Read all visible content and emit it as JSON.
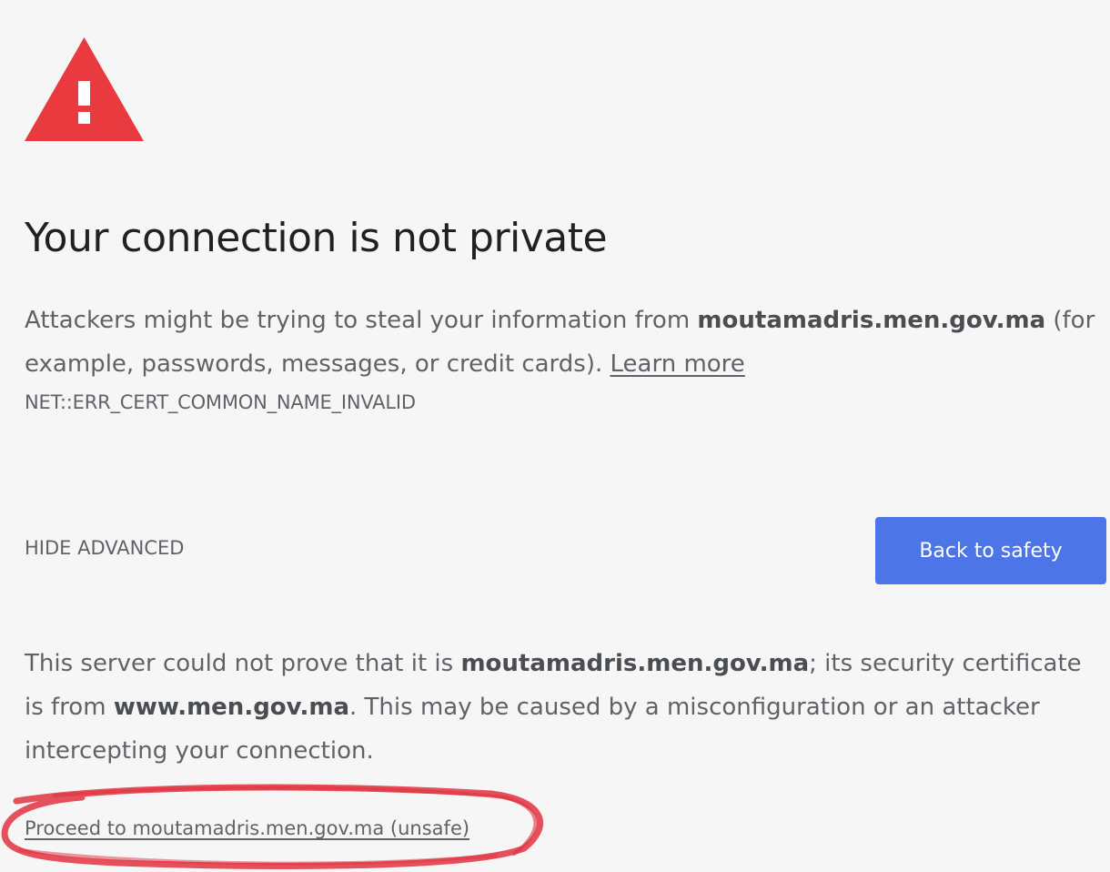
{
  "icon": {
    "name": "warning-triangle-icon",
    "color": "#e83a3f"
  },
  "heading": "Your connection is not private",
  "primary_paragraph": {
    "text_before": "Attackers might be trying to steal your information from ",
    "domain": "moutamadris.men.gov.ma",
    "text_after": " (for example, passwords, messages, or credit cards). ",
    "learn_more": "Learn more"
  },
  "error_code": "NET::ERR_CERT_COMMON_NAME_INVALID",
  "buttons": {
    "hide_advanced": "HIDE ADVANCED",
    "back_to_safety": "Back to safety",
    "primary_color": "#4c76e8"
  },
  "details_paragraph": {
    "text_before": "This server could not prove that it is ",
    "domain": "moutamadris.men.gov.ma",
    "text_middle": "; its security certificate is from ",
    "cert_domain": "www.men.gov.ma",
    "text_after": ". This may be caused by a misconfiguration or an attacker intercepting your connection."
  },
  "proceed_link": "Proceed to moutamadris.men.gov.ma (unsafe)",
  "annotation": {
    "color": "#e0323f"
  }
}
